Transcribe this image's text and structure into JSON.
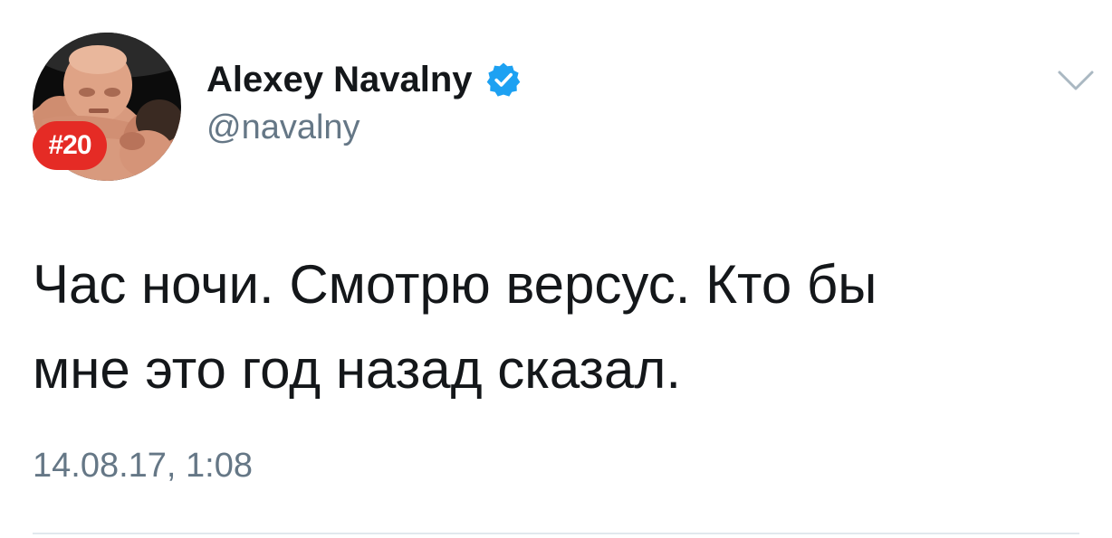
{
  "author": {
    "display_name": "Alexey Navalny",
    "handle": "@navalny",
    "verified": true,
    "avatar_badge": "#20",
    "avatar_icon": "avatar-photo-wrestlers"
  },
  "tweet": {
    "text": "Час ночи. Смотрю версус. Кто бы\nмне это год назад сказал.",
    "timestamp": "14.08.17, 1:08"
  },
  "icons": {
    "verified": "verified-badge-icon",
    "menu": "chevron-down-icon"
  },
  "colors": {
    "verified_blue": "#1da1f2",
    "text_primary": "#14171a",
    "text_secondary": "#657786",
    "badge_red": "#e52b25",
    "divider": "#e1e8ed"
  }
}
